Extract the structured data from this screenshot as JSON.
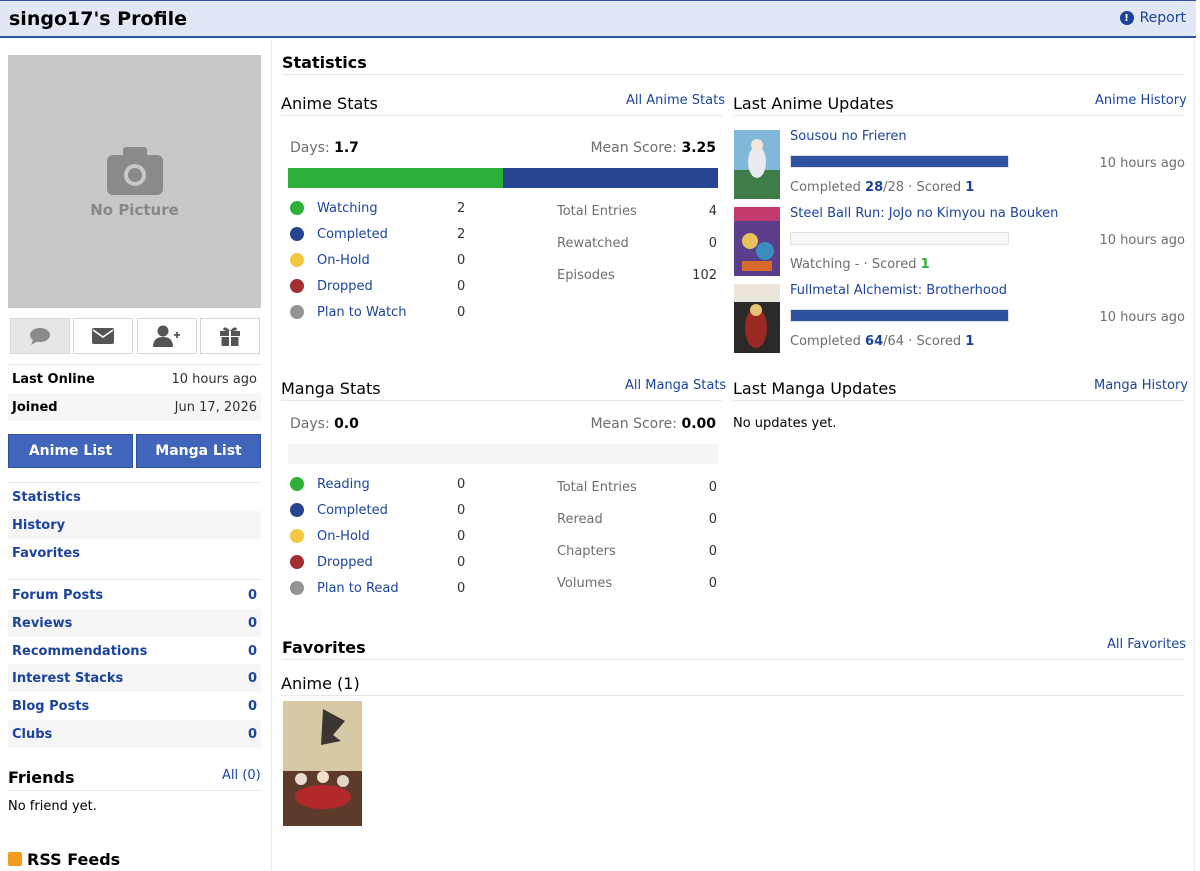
{
  "header": {
    "title": "singo17's Profile",
    "report_label": "Report"
  },
  "profile": {
    "no_picture": "No Picture",
    "last_online_label": "Last Online",
    "last_online_value": "10 hours ago",
    "joined_label": "Joined",
    "joined_value": "Jun 17, 2026",
    "anime_list_button": "Anime List",
    "manga_list_button": "Manga List"
  },
  "nav": {
    "statistics": "Statistics",
    "history": "History",
    "favorites": "Favorites"
  },
  "counts": [
    {
      "label": "Forum Posts",
      "value": "0"
    },
    {
      "label": "Reviews",
      "value": "0"
    },
    {
      "label": "Recommendations",
      "value": "0"
    },
    {
      "label": "Interest Stacks",
      "value": "0"
    },
    {
      "label": "Blog Posts",
      "value": "0"
    },
    {
      "label": "Clubs",
      "value": "0"
    }
  ],
  "friends": {
    "title": "Friends",
    "all_link": "All (0)",
    "empty": "No friend yet."
  },
  "rss": {
    "title": "RSS Feeds"
  },
  "statistics": {
    "title": "Statistics",
    "anime": {
      "title": "Anime Stats",
      "all_link": "All Anime Stats",
      "days_label": "Days:",
      "days_value": "1.7",
      "mean_label": "Mean Score:",
      "mean_value": "3.25",
      "bar_fractions": {
        "watching": 0.5,
        "completed": 0.5
      },
      "legend": [
        {
          "label": "Watching",
          "value": "2",
          "color": "#2db039"
        },
        {
          "label": "Completed",
          "value": "2",
          "color": "#26448f"
        },
        {
          "label": "On-Hold",
          "value": "0",
          "color": "#f1c83e"
        },
        {
          "label": "Dropped",
          "value": "0",
          "color": "#a12f31"
        },
        {
          "label": "Plan to Watch",
          "value": "0",
          "color": "#939393"
        }
      ],
      "totals": [
        {
          "label": "Total Entries",
          "value": "4"
        },
        {
          "label": "Rewatched",
          "value": "0"
        },
        {
          "label": "Episodes",
          "value": "102"
        }
      ]
    },
    "manga": {
      "title": "Manga Stats",
      "all_link": "All Manga Stats",
      "days_label": "Days:",
      "days_value": "0.0",
      "mean_label": "Mean Score:",
      "mean_value": "0.00",
      "legend": [
        {
          "label": "Reading",
          "value": "0",
          "color": "#2db039"
        },
        {
          "label": "Completed",
          "value": "0",
          "color": "#26448f"
        },
        {
          "label": "On-Hold",
          "value": "0",
          "color": "#f1c83e"
        },
        {
          "label": "Dropped",
          "value": "0",
          "color": "#a12f31"
        },
        {
          "label": "Plan to Read",
          "value": "0",
          "color": "#939393"
        }
      ],
      "totals": [
        {
          "label": "Total Entries",
          "value": "0"
        },
        {
          "label": "Reread",
          "value": "0"
        },
        {
          "label": "Chapters",
          "value": "0"
        },
        {
          "label": "Volumes",
          "value": "0"
        }
      ]
    }
  },
  "anime_updates": {
    "title": "Last Anime Updates",
    "history_link": "Anime History",
    "items": [
      {
        "title": "Sousou no Frieren",
        "progress": 1.0,
        "time": "10 hours ago",
        "status": "Completed",
        "count": "28",
        "total": "/28",
        "sep": " · Scored ",
        "score": "1"
      },
      {
        "title": "Steel Ball Run: JoJo no Kimyou na Bouken",
        "progress": 0.0,
        "time": "10 hours ago",
        "status": "Watching",
        "count": "",
        "total": " - · ",
        "sep": "Scored ",
        "score": "1"
      },
      {
        "title": "Fullmetal Alchemist: Brotherhood",
        "progress": 1.0,
        "time": "10 hours ago",
        "status": "Completed",
        "count": "64",
        "total": "/64",
        "sep": " · Scored ",
        "score": "1"
      }
    ]
  },
  "manga_updates": {
    "title": "Last Manga Updates",
    "history_link": "Manga History",
    "empty": "No updates yet."
  },
  "favorites": {
    "title": "Favorites",
    "all_link": "All Favorites",
    "anime_heading": "Anime (1)"
  }
}
